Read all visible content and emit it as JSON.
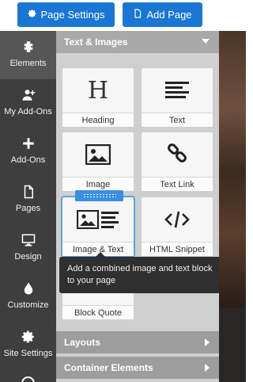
{
  "toolbar": {
    "page_settings": "Page Settings",
    "add_page": "Add Page",
    "accent": "#1976d2"
  },
  "sidebar": {
    "items": [
      {
        "label": "Elements",
        "icon": "puzzle-icon",
        "active": true
      },
      {
        "label": "My Add-Ons",
        "icon": "user-plus-icon"
      },
      {
        "label": "Add-Ons",
        "icon": "plus-icon"
      },
      {
        "label": "Pages",
        "icon": "page-icon"
      },
      {
        "label": "Design",
        "icon": "monitor-icon"
      },
      {
        "label": "Customize",
        "icon": "droplet-icon"
      },
      {
        "label": "Site Settings",
        "icon": "gear-icon"
      }
    ]
  },
  "panel": {
    "section_open": "Text & Images",
    "tiles": [
      {
        "label": "Heading",
        "icon": "heading-icon"
      },
      {
        "label": "Text",
        "icon": "text-lines-icon"
      },
      {
        "label": "Image",
        "icon": "image-icon"
      },
      {
        "label": "Text Link",
        "icon": "link-icon"
      },
      {
        "label": "Image & Text",
        "icon": "image-text-icon"
      },
      {
        "label": "HTML Snippet",
        "icon": "code-icon"
      },
      {
        "label": "Block Quote",
        "icon": "quote-icon"
      }
    ],
    "tooltip": "Add a combined image and text block to your page",
    "collapsed_sections": [
      "Layouts",
      "Container Elements"
    ]
  }
}
